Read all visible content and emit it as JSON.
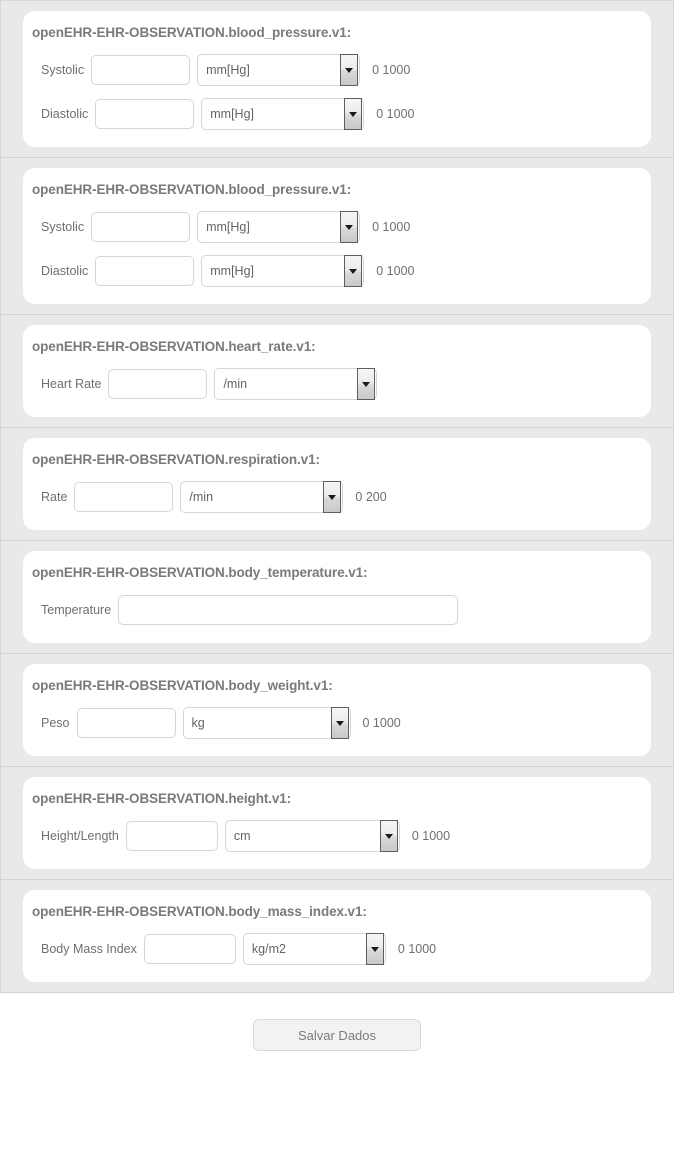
{
  "panels": [
    {
      "legend": "openEHR-EHR-OBSERVATION.blood_pressure.v1:",
      "fields": [
        {
          "label": "Systolic",
          "value": "",
          "unit": "mm[Hg]",
          "range": "0 1000"
        },
        {
          "label": "Diastolic",
          "value": "",
          "unit": "mm[Hg]",
          "range": "0 1000"
        }
      ]
    },
    {
      "legend": "openEHR-EHR-OBSERVATION.blood_pressure.v1:",
      "fields": [
        {
          "label": "Systolic",
          "value": "",
          "unit": "mm[Hg]",
          "range": "0 1000"
        },
        {
          "label": "Diastolic",
          "value": "",
          "unit": "mm[Hg]",
          "range": "0 1000"
        }
      ]
    },
    {
      "legend": "openEHR-EHR-OBSERVATION.heart_rate.v1:",
      "fields": [
        {
          "label": "Heart Rate",
          "value": "",
          "unit": "/min",
          "range": ""
        }
      ]
    },
    {
      "legend": "openEHR-EHR-OBSERVATION.respiration.v1:",
      "fields": [
        {
          "label": "Rate",
          "value": "",
          "unit": "/min",
          "range": "0 200"
        }
      ]
    },
    {
      "legend": "openEHR-EHR-OBSERVATION.body_temperature.v1:",
      "fields": [
        {
          "label": "Temperature",
          "value": "",
          "unit": "",
          "range": ""
        }
      ]
    },
    {
      "legend": "openEHR-EHR-OBSERVATION.body_weight.v1:",
      "fields": [
        {
          "label": "Peso",
          "value": "",
          "unit": "kg",
          "range": "0 1000"
        }
      ]
    },
    {
      "legend": "openEHR-EHR-OBSERVATION.height.v1:",
      "fields": [
        {
          "label": "Height/Length",
          "value": "",
          "unit": "cm",
          "range": "0 1000"
        }
      ]
    },
    {
      "legend": "openEHR-EHR-OBSERVATION.body_mass_index.v1:",
      "fields": [
        {
          "label": "Body Mass Index",
          "value": "",
          "unit": "kg/m2",
          "range": "0 1000"
        }
      ]
    }
  ],
  "actions": {
    "save_label": "Salvar Dados"
  },
  "icons": {
    "dropdown_arrow": "chevron-down-icon"
  },
  "colors": {
    "panel_background": "#e9e9e9",
    "card_background": "#ffffff",
    "legend_text": "#7a7a7a",
    "label_text": "#6f6f6f",
    "field_border": "#d6d6d6",
    "button_background": "#f2f2f2"
  }
}
